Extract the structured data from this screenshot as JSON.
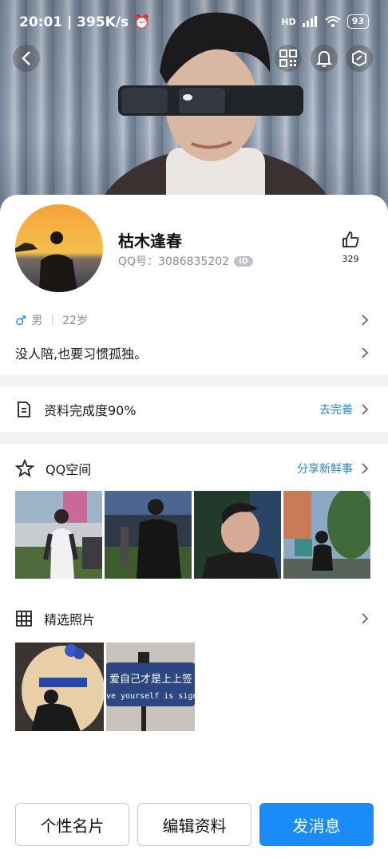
{
  "status_bar": {
    "time": "20:01",
    "speed": "395K/s",
    "battery": "93",
    "hd_label": "HD"
  },
  "header": {
    "back_icon": "chevron-left-icon",
    "qr_icon": "qr-code-icon",
    "bell_icon": "bell-icon",
    "shield_icon": "shield-icon"
  },
  "profile": {
    "nickname": "枯木逢春",
    "qq_label": "QQ号：3086835202",
    "id_badge": "iD",
    "like_count": "329",
    "gender_symbol": "♂",
    "gender": "男",
    "age": "22岁",
    "signature": "没人陪,也要习惯孤独。"
  },
  "completion": {
    "label": "资料完成度90%",
    "action": "去完善",
    "percent": 90
  },
  "qzone": {
    "title": "QQ空间",
    "action": "分享新鲜事"
  },
  "selected_photos": {
    "title": "精选照片"
  },
  "photo_texts": {
    "sign_line1": "爱自己才是上上签",
    "sign_line2": "ve yourself is sign"
  },
  "buttons": {
    "card": "个性名片",
    "edit": "编辑资料",
    "message": "发消息"
  },
  "colors": {
    "accent": "#1a8cf8",
    "link": "#2a86c8"
  }
}
